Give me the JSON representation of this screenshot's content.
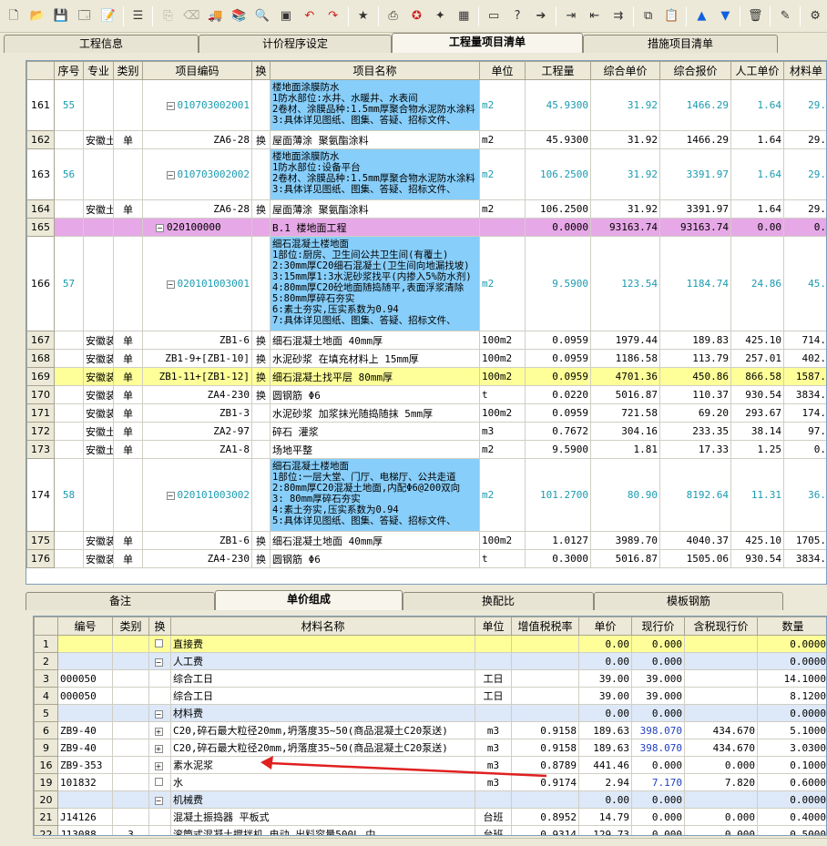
{
  "toolbar_icons": [
    "new-file-icon",
    "open-folder-icon",
    "save-icon",
    "properties-icon",
    "edit-icon",
    "list-icon",
    "copy-disabled-icon",
    "clear-disabled-icon",
    "truck-icon",
    "books-icon",
    "search-item-icon",
    "window-icon",
    "undo-icon",
    "redo-icon",
    "star-icon",
    "print-icon",
    "lifebuoy-icon",
    "wand-icon",
    "calculator-icon",
    "monitor-icon",
    "help-icon",
    "go-icon",
    "indent-icon",
    "outdent-icon",
    "expand-icon",
    "copy-icon",
    "paste-icon",
    "up-arrow-icon",
    "down-arrow-icon",
    "delete-icon",
    "pencil-icon",
    "settings-grid-icon"
  ],
  "top_tabs": [
    "工程信息",
    "计价程序设定",
    "工程量项目清单",
    "措施项目清单"
  ],
  "top_active": 2,
  "main_headers": [
    "",
    "序号",
    "专业",
    "类别",
    "项目编码",
    "换",
    "项目名称",
    "单位",
    "工程量",
    "综合单价",
    "综合报价",
    "人工单价",
    "材料单"
  ],
  "main_rows": [
    {
      "type": "blue",
      "rn": "161",
      "seq": "55",
      "major": "",
      "cat": "",
      "code": "010703002001",
      "sw": "",
      "name": "楼地面涂膜防水\n1防水部位:水井、水暖井、水表间\n2卷材、涂膜品种:1.5mm厚聚合物水泥防水涂料\n3:具体详见图纸、图集、答疑、招标文件、",
      "unit": "m2",
      "qty": "45.9300",
      "up": "31.92",
      "total": "1466.29",
      "labor": "1.64",
      "mat": "29."
    },
    {
      "type": "plain",
      "rn": "162",
      "seq": "",
      "major": "安徽土",
      "cat": "单",
      "code": "ZA6-28",
      "sw": "换",
      "name": "屋面薄涂 聚氨酯涂料",
      "unit": "m2",
      "qty": "45.9300",
      "up": "31.92",
      "total": "1466.29",
      "labor": "1.64",
      "mat": "29."
    },
    {
      "type": "blue",
      "rn": "163",
      "seq": "56",
      "major": "",
      "cat": "",
      "code": "010703002002",
      "sw": "",
      "name": "楼地面涂膜防水\n1防水部位:设备平台\n2卷材、涂膜品种:1.5mm厚聚合物水泥防水涂料\n3:具体详见图纸、图集、答疑、招标文件、",
      "unit": "m2",
      "qty": "106.2500",
      "up": "31.92",
      "total": "3391.97",
      "labor": "1.64",
      "mat": "29."
    },
    {
      "type": "plain",
      "rn": "164",
      "seq": "",
      "major": "安徽土",
      "cat": "单",
      "code": "ZA6-28",
      "sw": "换",
      "name": "屋面薄涂 聚氨酯涂料",
      "unit": "m2",
      "qty": "106.2500",
      "up": "31.92",
      "total": "3391.97",
      "labor": "1.64",
      "mat": "29."
    },
    {
      "type": "pink",
      "rn": "165",
      "seq": "",
      "major": "",
      "cat": "",
      "code": "020100000",
      "sw": "",
      "name": "B.1 楼地面工程",
      "unit": "",
      "qty": "0.0000",
      "up": "93163.74",
      "total": "93163.74",
      "labor": "0.00",
      "mat": "0."
    },
    {
      "type": "blue",
      "rn": "166",
      "seq": "57",
      "major": "",
      "cat": "",
      "code": "020101003001",
      "sw": "",
      "name": "细石混凝土楼地面\n1部位:厨房、卫生间公共卫生间(有覆土)\n2:30mm厚C20细石混凝土(卫生间向地漏找坡)\n3:15mm厚1:3水泥砂浆找平(内掺入5%防水剂)\n4:80mm厚C20砼地面随捣随平,表面浮浆清除\n5:80mm厚碎石夯实\n6:素土夯实,压实系数为0.94\n7:具体详见图纸、图集、答疑、招标文件、",
      "unit": "m2",
      "qty": "9.5900",
      "up": "123.54",
      "total": "1184.74",
      "labor": "24.86",
      "mat": "45."
    },
    {
      "type": "plain",
      "rn": "167",
      "seq": "",
      "major": "安徽装",
      "cat": "单",
      "code": "ZB1-6",
      "sw": "换",
      "name": "细石混凝土地面 40mm厚",
      "unit": "100m2",
      "qty": "0.0959",
      "up": "1979.44",
      "total": "189.83",
      "labor": "425.10",
      "mat": "714."
    },
    {
      "type": "plain",
      "rn": "168",
      "seq": "",
      "major": "安徽装",
      "cat": "单",
      "code": "ZB1-9+[ZB1-10]",
      "sw": "换",
      "name": "水泥砂浆 在填充材料上 15mm厚",
      "unit": "100m2",
      "qty": "0.0959",
      "up": "1186.58",
      "total": "113.79",
      "labor": "257.01",
      "mat": "402."
    },
    {
      "type": "yellow",
      "rn": "169",
      "seq": "",
      "major": "安徽装",
      "cat": "单",
      "code": "ZB1-11+[ZB1-12]",
      "sw": "换",
      "name": "细石混凝土找平层 80mm厚",
      "unit": "100m2",
      "qty": "0.0959",
      "up": "4701.36",
      "total": "450.86",
      "labor": "866.58",
      "mat": "1587."
    },
    {
      "type": "plain",
      "rn": "170",
      "seq": "",
      "major": "安徽装",
      "cat": "单",
      "code": "ZA4-230",
      "sw": "换",
      "name": "圆钢筋 Φ6",
      "unit": "t",
      "qty": "0.0220",
      "up": "5016.87",
      "total": "110.37",
      "labor": "930.54",
      "mat": "3834."
    },
    {
      "type": "plain",
      "rn": "171",
      "seq": "",
      "major": "安徽装",
      "cat": "单",
      "code": "ZB1-3",
      "sw": "",
      "name": "水泥砂浆 加浆抹光随捣随抹 5mm厚",
      "unit": "100m2",
      "qty": "0.0959",
      "up": "721.58",
      "total": "69.20",
      "labor": "293.67",
      "mat": "174."
    },
    {
      "type": "plain",
      "rn": "172",
      "seq": "",
      "major": "安徽土",
      "cat": "单",
      "code": "ZA2-97",
      "sw": "",
      "name": "碎石 灌浆",
      "unit": "m3",
      "qty": "0.7672",
      "up": "304.16",
      "total": "233.35",
      "labor": "38.14",
      "mat": "97."
    },
    {
      "type": "plain",
      "rn": "173",
      "seq": "",
      "major": "安徽土",
      "cat": "单",
      "code": "ZA1-8",
      "sw": "",
      "name": "场地平整",
      "unit": "m2",
      "qty": "9.5900",
      "up": "1.81",
      "total": "17.33",
      "labor": "1.25",
      "mat": "0."
    },
    {
      "type": "blue",
      "rn": "174",
      "seq": "58",
      "major": "",
      "cat": "",
      "code": "020101003002",
      "sw": "",
      "name": "细石混凝土楼地面\n1部位:一层大堂、门厅、电梯厅、公共走道\n2:80mm厚C20混凝土地面,内配Φ6@200双向\n3: 80mm厚碎石夯实\n4:素土夯实,压实系数为0.94\n5:具体详见图纸、图集、答疑、招标文件、",
      "unit": "m2",
      "qty": "101.2700",
      "up": "80.90",
      "total": "8192.64",
      "labor": "11.31",
      "mat": "36."
    },
    {
      "type": "plain",
      "rn": "175",
      "seq": "",
      "major": "安徽装",
      "cat": "单",
      "code": "ZB1-6",
      "sw": "换",
      "name": "细石混凝土地面 40mm厚",
      "unit": "100m2",
      "qty": "1.0127",
      "up": "3989.70",
      "total": "4040.37",
      "labor": "425.10",
      "mat": "1705."
    },
    {
      "type": "plain",
      "rn": "176",
      "seq": "",
      "major": "安徽装",
      "cat": "单",
      "code": "ZA4-230",
      "sw": "换",
      "name": "圆钢筋 Φ6",
      "unit": "t",
      "qty": "0.3000",
      "up": "5016.87",
      "total": "1505.06",
      "labor": "930.54",
      "mat": "3834."
    }
  ],
  "bottom_tabs": [
    "备注",
    "单价组成",
    "换配比",
    "模板钢筋"
  ],
  "bottom_active": 1,
  "bottom_headers": [
    "",
    "编号",
    "类别",
    "换",
    "材料名称",
    "单位",
    "增值税税率",
    "单价",
    "现行价",
    "含税现行价",
    "数量"
  ],
  "bottom_rows": [
    {
      "type": "yellow",
      "rn": "1",
      "code": "",
      "cat": "",
      "sw": "□",
      "name": "直接费",
      "unit": "",
      "tax": "",
      "price": "0.00",
      "cur": "0.000",
      "taxcur": "",
      "qty": "0.0000"
    },
    {
      "type": "sub",
      "rn": "2",
      "code": "",
      "cat": "",
      "sw": "⊟",
      "name": "人工费",
      "unit": "",
      "tax": "",
      "price": "0.00",
      "cur": "0.000",
      "taxcur": "",
      "qty": "0.0000"
    },
    {
      "type": "plain",
      "rn": "3",
      "code": "000050",
      "cat": "",
      "sw": "",
      "name": "综合工日",
      "unit": "工日",
      "tax": "",
      "price": "39.00",
      "cur": "39.000",
      "taxcur": "",
      "qty": "14.1000"
    },
    {
      "type": "plain",
      "rn": "4",
      "code": "000050",
      "cat": "",
      "sw": "",
      "name": "综合工日",
      "unit": "工日",
      "tax": "",
      "price": "39.00",
      "cur": "39.000",
      "taxcur": "",
      "qty": "8.1200"
    },
    {
      "type": "sub",
      "rn": "5",
      "code": "",
      "cat": "",
      "sw": "⊟",
      "name": "材料费",
      "unit": "",
      "tax": "",
      "price": "0.00",
      "cur": "0.000",
      "taxcur": "",
      "qty": "0.0000"
    },
    {
      "type": "plain",
      "rn": "6",
      "code": "ZB9-40",
      "cat": "",
      "sw": "⊞",
      "name": "C20,碎石最大粒径20mm,坍落度35~50(商品混凝土C20泵送)",
      "unit": "m3",
      "tax": "0.9158",
      "price": "189.63",
      "cur": "398.070",
      "taxcur": "434.670",
      "qty": "5.1000",
      "curblue": true
    },
    {
      "type": "plain",
      "rn": "9",
      "code": "ZB9-40",
      "cat": "",
      "sw": "⊞",
      "name": "C20,碎石最大粒径20mm,坍落度35~50(商品混凝土C20泵送)",
      "unit": "m3",
      "tax": "0.9158",
      "price": "189.63",
      "cur": "398.070",
      "taxcur": "434.670",
      "qty": "3.0300",
      "curblue": true
    },
    {
      "type": "plain",
      "rn": "16",
      "code": "ZB9-353",
      "cat": "",
      "sw": "⊞",
      "name": "素水泥浆",
      "unit": "m3",
      "tax": "0.8789",
      "price": "441.46",
      "cur": "0.000",
      "taxcur": "0.000",
      "qty": "0.1000"
    },
    {
      "type": "plain",
      "rn": "19",
      "code": "101832",
      "cat": "",
      "sw": "□",
      "name": "水",
      "unit": "m3",
      "tax": "0.9174",
      "price": "2.94",
      "cur": "7.170",
      "taxcur": "7.820",
      "qty": "0.6000",
      "curblue": true
    },
    {
      "type": "sub",
      "rn": "20",
      "code": "",
      "cat": "",
      "sw": "⊟",
      "name": "机械费",
      "unit": "",
      "tax": "",
      "price": "0.00",
      "cur": "0.000",
      "taxcur": "",
      "qty": "0.0000"
    },
    {
      "type": "plain",
      "rn": "21",
      "code": "J14126",
      "cat": "",
      "sw": "",
      "name": "混凝土振捣器 平板式",
      "unit": "台班",
      "tax": "0.8952",
      "price": "14.79",
      "cur": "0.000",
      "taxcur": "0.000",
      "qty": "0.4000"
    },
    {
      "type": "plain",
      "rn": "22",
      "code": "J13088",
      "cat": "3",
      "sw": "",
      "name": "滚筒式混凝土搅拌机,电动,出料容量500L,中",
      "unit": "台班",
      "tax": "0.9314",
      "price": "129.73",
      "cur": "0.000",
      "taxcur": "0.000",
      "qty": "0.5000"
    }
  ],
  "colors": {
    "blue_name": "#87cefa",
    "pink_row": "#e6a8e6",
    "yellow_row": "#ffff99",
    "teal_text": "#1a9ab0",
    "arrow": "#e02020"
  }
}
